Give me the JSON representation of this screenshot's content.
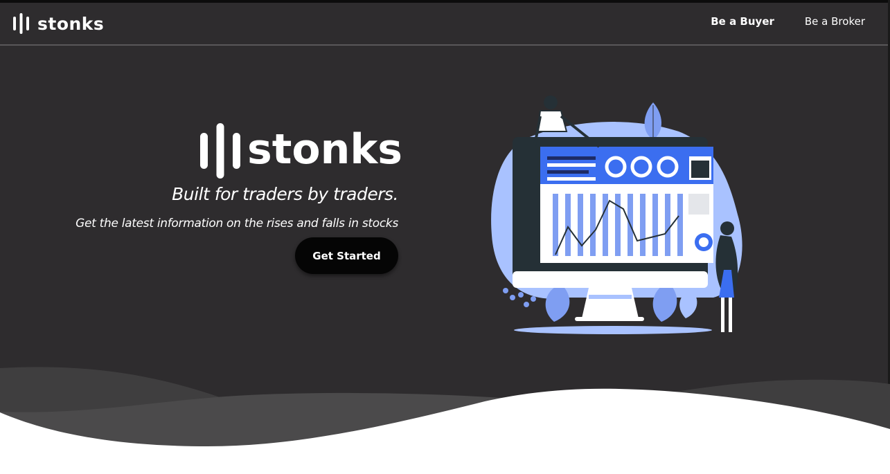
{
  "nav": {
    "brand": "stonks",
    "links": [
      {
        "label": "Be a Buyer"
      },
      {
        "label": "Be a Broker"
      }
    ]
  },
  "hero": {
    "logo_word": "stonks",
    "tagline": "Built for traders by traders.",
    "subline": "Get the latest information on the rises and falls in stocks",
    "cta_label": "Get Started"
  },
  "colors": {
    "background": "#2e2c2e",
    "accent": "#3b6ef0",
    "light_accent": "#a9c2ff",
    "button": "#050505"
  },
  "illustration": {
    "icon": "trader-dashboard-illustration"
  }
}
